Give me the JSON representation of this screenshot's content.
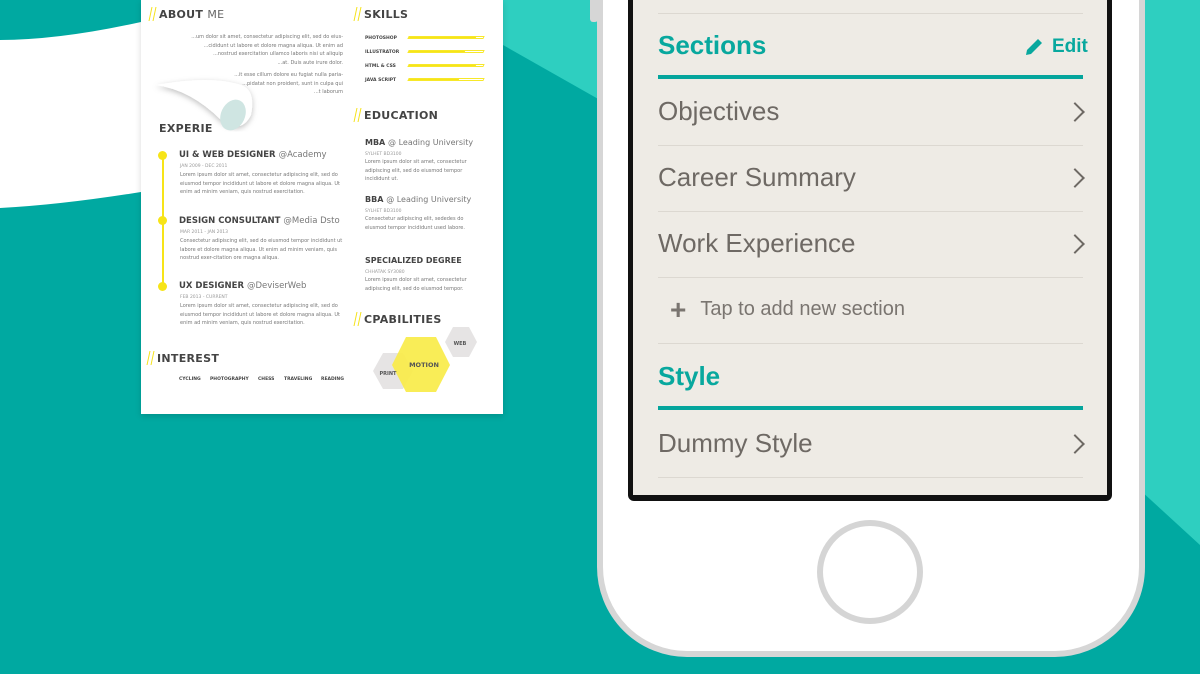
{
  "colors": {
    "background": "#00a9a1",
    "background_light": "#2ecfc0",
    "accent": "#04a59c",
    "resume_accent": "#f7e418",
    "screen_bg": "#eeebe5"
  },
  "resume": {
    "about": {
      "title_bold": "ABOUT",
      "title_light": "ME",
      "lines": [
        "...um dolor sit amet, consectetur adipiscing elit, sed do eius-",
        "...cididunt ut labore et dolore magna aliqua. Ut enim ad",
        "...nostrud exercitation ullamco laboris nisi ut aliquip",
        "...at. Duis aute irure dolor.",
        "...it esse cillum dolore eu fugiat nulla paria-",
        "...pidatat non proident, sunt in culpa qui",
        "...t laborum"
      ]
    },
    "experience": {
      "title": "EXPERIE",
      "jobs": [
        {
          "role": "UI & WEB DESIGNER",
          "company": "@Academy",
          "date": "JAN 2009 - DEC 2011",
          "text": "Lorem ipsum dolor sit amet, consectetur adipiscing elit, sed do eiusmod tempor incididunt ut labore et dolore magna aliqua. Ut enim ad minim veniam, quis nostrud exercitation."
        },
        {
          "role": "DESIGN CONSULTANT",
          "company": "@Media Dsto",
          "date": "MAR 2011 - JAN 2013",
          "text": "Consectetur adipiscing elit, sed do eiusmod tempor incididunt ut labore et dolore magna aliqua. Ut enim ad minim veniam, quis nostrud exer-citation ore magna aliqua."
        },
        {
          "role": "UX DESIGNER",
          "company": "@DeviserWeb",
          "date": "FEB 2013 - CURRENT",
          "text": "Lorem ipsum dolor sit amet, consectetur adipiscing elit, sed do eiusmod tempor incididunt ut labore et dolore magna aliqua. Ut enim ad minim veniam, quis nostrud exercitation."
        }
      ]
    },
    "interest": {
      "title": "INTEREST",
      "items": [
        "CYCLING",
        "PHOTOGRAPHY",
        "CHESS",
        "TRAVELING",
        "READING"
      ]
    },
    "skills": {
      "title": "SKILLS",
      "items": [
        {
          "name": "PHOTOSHOP",
          "level": 0.9
        },
        {
          "name": "ILLUSTRATOR",
          "level": 0.75
        },
        {
          "name": "HTML & CSS",
          "level": 0.9
        },
        {
          "name": "JAVA SCRIPT",
          "level": 0.68
        }
      ]
    },
    "education": {
      "title": "EDUCATION",
      "items": [
        {
          "degree": "MBA",
          "school": "@ Leading University",
          "place": "SYLHET BD3100",
          "text": "Lorem ipsum dolor sit amet, consectetur adipiscing elit, sed do eiusmod tempor incididunt ut."
        },
        {
          "degree": "BBA",
          "school": "@ Leading University",
          "place": "SYLHET BD3100",
          "text": "Consectetur adipiscing elit, sededes do eiusmod tempor incididunt used labore."
        },
        {
          "degree": "SPECIALIZED DEGREE",
          "school": "",
          "place": "CHHATAK SY3080",
          "text": "Lorem ipsum dolor sit amet, consectetur adipiscing elit, sed do eiusmod tempor."
        }
      ]
    },
    "capabilities": {
      "title": "CPABILITIES",
      "items": [
        "PRINT",
        "MOTION",
        "WEB"
      ]
    }
  },
  "app": {
    "sections_title": "Sections",
    "edit_label": "Edit",
    "sections": [
      "Objectives",
      "Career Summary",
      "Work Experience"
    ],
    "add_section": "Tap to add new section",
    "style_title": "Style",
    "styles": [
      "Dummy Style"
    ]
  }
}
